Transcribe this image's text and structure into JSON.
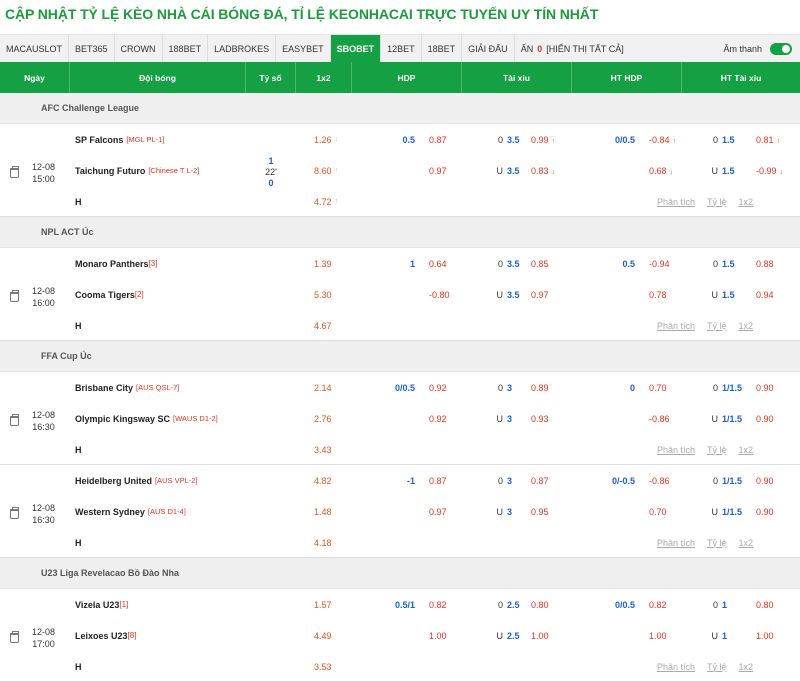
{
  "title": "CẬP NHẬT TỶ LỆ KÈO NHÀ CÁI BÓNG ĐÁ, TỈ LỆ KEONHACAI TRỰC TUYẾN UY TÍN NHẤT",
  "bookmakers": [
    "MACAUSLOT",
    "BET365",
    "CROWN",
    "188BET",
    "LADBROKES",
    "EASYBET",
    "SBOBET",
    "12BET",
    "18BET",
    "GIẢI ĐẤU"
  ],
  "active_bookmaker": "SBOBET",
  "hide_label": "ẨN",
  "hide_count": "0",
  "show_all": "[HIỂN THỊ TẤT CẢ]",
  "sound_label": "Âm thanh",
  "colors": {
    "brand_green": "#14a043",
    "title_green": "#1c9c3c",
    "odds_red": "#e3331f",
    "odds_blue": "#1a5fd6"
  },
  "headers": [
    "Ngày",
    "Đội bóng",
    "Tỷ số",
    "1x2",
    "HDP",
    "Tài xỉu",
    "HT HDP",
    "HT Tài xỉu"
  ],
  "links": {
    "analysis": "Phân tích",
    "odds": "Tỷ lệ",
    "x12": "1x2"
  },
  "leagues": [
    {
      "name": "AFC Challenge League",
      "matches": [
        {
          "date": "12-08",
          "time": "15:00",
          "score_home": "1",
          "minute": "22'",
          "score_away": "0",
          "rows": [
            {
              "team": "SP Falcons",
              "tag": "[MGL PL-1]",
              "x12": "1.26",
              "x12_arrow": "down",
              "hdp_line": "0.5",
              "hdp_odds": "0.87",
              "tx_side": "0",
              "tx_line": "3.5",
              "tx_odds": "0.99",
              "tx_arrow": "up",
              "hthdp_line": "0/0.5",
              "hthdp_odds": "-0.84",
              "hthdp_arrow": "up",
              "httx_side": "0",
              "httx_line": "1.5",
              "httx_odds": "0.81",
              "httx_arrow": "up"
            },
            {
              "team": "Taichung Futuro",
              "tag": "[Chinese T L-2]",
              "x12": "8.60",
              "x12_arrow": "up",
              "hdp_line": "",
              "hdp_odds": "0.97",
              "tx_side": "U",
              "tx_line": "3.5",
              "tx_odds": "0.83",
              "tx_arrow": "down",
              "hthdp_line": "",
              "hthdp_odds": "0.68",
              "hthdp_arrow": "down",
              "httx_side": "U",
              "httx_line": "1.5",
              "httx_odds": "-0.99",
              "httx_arrow": "down"
            },
            {
              "team": "H",
              "x12": "4.72",
              "x12_arrow": "up"
            }
          ]
        }
      ]
    },
    {
      "name": "NPL ACT Úc",
      "matches": [
        {
          "date": "12-08",
          "time": "16:00",
          "rows": [
            {
              "team": "Monaro Panthers",
              "rank": "[3]",
              "x12": "1.39",
              "hdp_line": "1",
              "hdp_odds": "0.64",
              "tx_side": "0",
              "tx_line": "3.5",
              "tx_odds": "0.85",
              "hthdp_line": "0.5",
              "hthdp_odds": "-0.94",
              "httx_side": "0",
              "httx_line": "1.5",
              "httx_odds": "0.88"
            },
            {
              "team": "Cooma Tigers",
              "rank": "[2]",
              "x12": "5.30",
              "hdp_line": "",
              "hdp_odds": "-0.80",
              "tx_side": "U",
              "tx_line": "3.5",
              "tx_odds": "0.97",
              "hthdp_line": "",
              "hthdp_odds": "0.78",
              "httx_side": "U",
              "httx_line": "1.5",
              "httx_odds": "0.94"
            },
            {
              "team": "H",
              "x12": "4.67"
            }
          ]
        }
      ]
    },
    {
      "name": "FFA Cup Úc",
      "matches": [
        {
          "date": "12-08",
          "time": "16:30",
          "rows": [
            {
              "team": "Brisbane City",
              "tag": "[AUS QSL-7]",
              "x12": "2.14",
              "hdp_line": "0/0.5",
              "hdp_odds": "0.92",
              "tx_side": "0",
              "tx_line": "3",
              "tx_odds": "0.89",
              "hthdp_line": "0",
              "hthdp_odds": "0.70",
              "httx_side": "0",
              "httx_line": "1/1.5",
              "httx_odds": "0.90"
            },
            {
              "team": "Olympic Kingsway SC",
              "tag": "[WAUS D1-2]",
              "x12": "2.76",
              "hdp_line": "",
              "hdp_odds": "0.92",
              "tx_side": "U",
              "tx_line": "3",
              "tx_odds": "0.93",
              "hthdp_line": "",
              "hthdp_odds": "-0.86",
              "httx_side": "U",
              "httx_line": "1/1.5",
              "httx_odds": "0.90"
            },
            {
              "team": "H",
              "x12": "3.43"
            }
          ]
        },
        {
          "date": "12-08",
          "time": "16:30",
          "rows": [
            {
              "team": "Heidelberg United",
              "tag": "[AUS VPL-2]",
              "x12": "4.82",
              "hdp_line": "-1",
              "hdp_odds": "0.87",
              "tx_side": "0",
              "tx_line": "3",
              "tx_odds": "0.87",
              "hthdp_line": "0/-0.5",
              "hthdp_odds": "-0.86",
              "httx_side": "0",
              "httx_line": "1/1.5",
              "httx_odds": "0.90"
            },
            {
              "team": "Western Sydney",
              "tag": "[AUS D1-4]",
              "x12": "1.48",
              "hdp_line": "",
              "hdp_odds": "0.97",
              "tx_side": "U",
              "tx_line": "3",
              "tx_odds": "0.95",
              "hthdp_line": "",
              "hthdp_odds": "0.70",
              "httx_side": "U",
              "httx_line": "1/1.5",
              "httx_odds": "0.90"
            },
            {
              "team": "H",
              "x12": "4.18"
            }
          ]
        }
      ]
    },
    {
      "name": "U23 Liga Revelacao Bồ Đào Nha",
      "matches": [
        {
          "date": "12-08",
          "time": "17:00",
          "rows": [
            {
              "team": "Vizela U23",
              "rank": "[1]",
              "x12": "1.57",
              "hdp_line": "0.5/1",
              "hdp_odds": "0.82",
              "tx_side": "0",
              "tx_line": "2.5",
              "tx_odds": "0.80",
              "hthdp_line": "0/0.5",
              "hthdp_odds": "0.82",
              "httx_side": "0",
              "httx_line": "1",
              "httx_odds": "0.80"
            },
            {
              "team": "Leixoes U23",
              "rank": "[8]",
              "x12": "4.49",
              "hdp_line": "",
              "hdp_odds": "1.00",
              "tx_side": "U",
              "tx_line": "2.5",
              "tx_odds": "1.00",
              "hthdp_line": "",
              "hthdp_odds": "1.00",
              "httx_side": "U",
              "httx_line": "1",
              "httx_odds": "1.00"
            },
            {
              "team": "H",
              "x12": "3.53"
            }
          ]
        }
      ]
    }
  ]
}
